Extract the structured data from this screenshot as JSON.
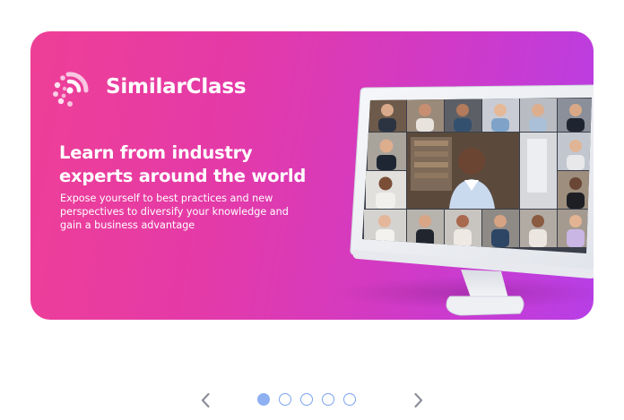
{
  "brand": {
    "name": "SimilarClass",
    "logo_icon": "similarclass-logo-icon"
  },
  "hero": {
    "headline": "Learn from industry experts around the world",
    "description": "Expose yourself to best practices and new perspectives to diversify your knowledge and gain a business advantage",
    "illustration": "video-conference-monitor"
  },
  "carousel": {
    "slide_count": 5,
    "active_index": 0,
    "prev_icon": "chevron-left-icon",
    "next_icon": "chevron-right-icon"
  },
  "colors": {
    "gradient_start": "#ee3f96",
    "gradient_end": "#b73ee6",
    "dot_active": "#8eb0f3",
    "dot_border": "#7aa2f0",
    "arrow": "#8c8f99"
  }
}
